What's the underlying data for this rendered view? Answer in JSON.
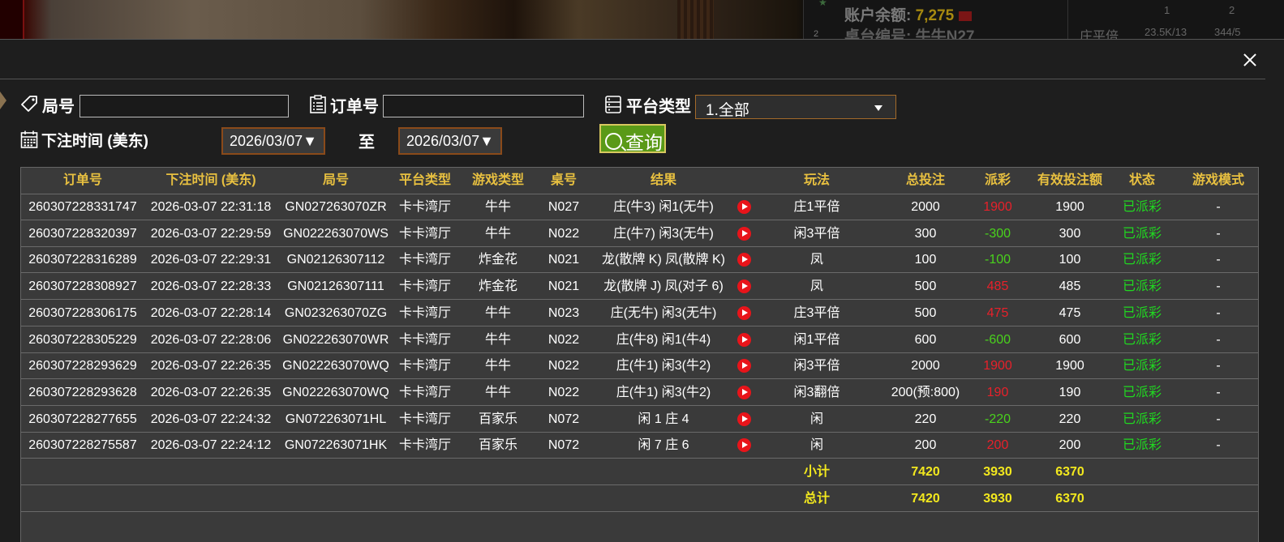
{
  "background": {
    "balance_label": "账户余额: ",
    "balance_value": "7,275",
    "table_label": "桌台编号: 牛牛N27",
    "grid_col1": "1",
    "grid_col2": "2",
    "grid_row_label": "庄平倍",
    "grid_val1": "23.5K/13",
    "grid_val2": "344/5",
    "row_number": "2"
  },
  "filters": {
    "round_label": "局号",
    "round_value": "",
    "order_label": "订单号",
    "order_value": "",
    "platform_label": "平台类型",
    "platform_selected": "1.全部",
    "time_label": "下注时间 (美东)",
    "date_from": "2026/03/07▼",
    "to_label": "至",
    "date_to": "2026/03/07▼",
    "query_label": "查询"
  },
  "table": {
    "headers": [
      "订单号",
      "下注时间 (美东)",
      "局号",
      "平台类型",
      "游戏类型",
      "桌号",
      "结果",
      "玩法",
      "总投注",
      "派彩",
      "有效投注额",
      "状态",
      "游戏模式"
    ],
    "rows": [
      {
        "order": "260307228331747",
        "time": "2026-03-07 22:31:18",
        "round": "GN027263070ZR",
        "platform": "卡卡湾厅",
        "game": "牛牛",
        "table": "N027",
        "result": "庄(牛3) 闲1(无牛)",
        "play": "庄1平倍",
        "bet": "2000",
        "payout": "1900",
        "payout_sign": "pos",
        "valid": "1900",
        "status": "已派彩",
        "mode": "-"
      },
      {
        "order": "260307228320397",
        "time": "2026-03-07 22:29:59",
        "round": "GN022263070WS",
        "platform": "卡卡湾厅",
        "game": "牛牛",
        "table": "N022",
        "result": "庄(牛7) 闲3(无牛)",
        "play": "闲3平倍",
        "bet": "300",
        "payout": "-300",
        "payout_sign": "neg",
        "valid": "300",
        "status": "已派彩",
        "mode": "-"
      },
      {
        "order": "260307228316289",
        "time": "2026-03-07 22:29:31",
        "round": "GN02126307112",
        "platform": "卡卡湾厅",
        "game": "炸金花",
        "table": "N021",
        "result": "龙(散牌 K) 凤(散牌 K)",
        "play": "凤",
        "bet": "100",
        "payout": "-100",
        "payout_sign": "neg",
        "valid": "100",
        "status": "已派彩",
        "mode": "-"
      },
      {
        "order": "260307228308927",
        "time": "2026-03-07 22:28:33",
        "round": "GN02126307111",
        "platform": "卡卡湾厅",
        "game": "炸金花",
        "table": "N021",
        "result": "龙(散牌 J) 凤(对子 6)",
        "play": "凤",
        "bet": "500",
        "payout": "485",
        "payout_sign": "pos",
        "valid": "485",
        "status": "已派彩",
        "mode": "-"
      },
      {
        "order": "260307228306175",
        "time": "2026-03-07 22:28:14",
        "round": "GN023263070ZG",
        "platform": "卡卡湾厅",
        "game": "牛牛",
        "table": "N023",
        "result": "庄(无牛) 闲3(无牛)",
        "play": "庄3平倍",
        "bet": "500",
        "payout": "475",
        "payout_sign": "pos",
        "valid": "475",
        "status": "已派彩",
        "mode": "-"
      },
      {
        "order": "260307228305229",
        "time": "2026-03-07 22:28:06",
        "round": "GN022263070WR",
        "platform": "卡卡湾厅",
        "game": "牛牛",
        "table": "N022",
        "result": "庄(牛8) 闲1(牛4)",
        "play": "闲1平倍",
        "bet": "600",
        "payout": "-600",
        "payout_sign": "neg",
        "valid": "600",
        "status": "已派彩",
        "mode": "-"
      },
      {
        "order": "260307228293629",
        "time": "2026-03-07 22:26:35",
        "round": "GN022263070WQ",
        "platform": "卡卡湾厅",
        "game": "牛牛",
        "table": "N022",
        "result": "庄(牛1) 闲3(牛2)",
        "play": "闲3平倍",
        "bet": "2000",
        "payout": "1900",
        "payout_sign": "pos",
        "valid": "1900",
        "status": "已派彩",
        "mode": "-"
      },
      {
        "order": "260307228293628",
        "time": "2026-03-07 22:26:35",
        "round": "GN022263070WQ",
        "platform": "卡卡湾厅",
        "game": "牛牛",
        "table": "N022",
        "result": "庄(牛1) 闲3(牛2)",
        "play": "闲3翻倍",
        "bet": "200(预:800)",
        "payout": "190",
        "payout_sign": "pos",
        "valid": "190",
        "status": "已派彩",
        "mode": "-"
      },
      {
        "order": "260307228277655",
        "time": "2026-03-07 22:24:32",
        "round": "GN072263071HL",
        "platform": "卡卡湾厅",
        "game": "百家乐",
        "table": "N072",
        "result": "闲 1 庄 4",
        "play": "闲",
        "bet": "220",
        "payout": "-220",
        "payout_sign": "neg",
        "valid": "220",
        "status": "已派彩",
        "mode": "-"
      },
      {
        "order": "260307228275587",
        "time": "2026-03-07 22:24:12",
        "round": "GN072263071HK",
        "platform": "卡卡湾厅",
        "game": "百家乐",
        "table": "N072",
        "result": "闲 7 庄 6",
        "play": "闲",
        "bet": "200",
        "payout": "200",
        "payout_sign": "pos",
        "valid": "200",
        "status": "已派彩",
        "mode": "-"
      }
    ],
    "subtotal": {
      "label": "小计",
      "bet": "7420",
      "payout": "3930",
      "valid": "6370"
    },
    "total": {
      "label": "总计",
      "bet": "7420",
      "payout": "3930",
      "valid": "6370"
    }
  },
  "colors": {
    "header_text": "#e8c040",
    "positive_payout": "#e8202a",
    "negative_payout": "#49d21c",
    "status_paid": "#20d820",
    "summary_text": "#f2e81e",
    "query_button": "#5a9a18"
  },
  "icons": [
    "tag-icon",
    "clipboard-icon",
    "server-icon",
    "calendar-icon",
    "search-icon",
    "close-icon",
    "play-icon"
  ]
}
